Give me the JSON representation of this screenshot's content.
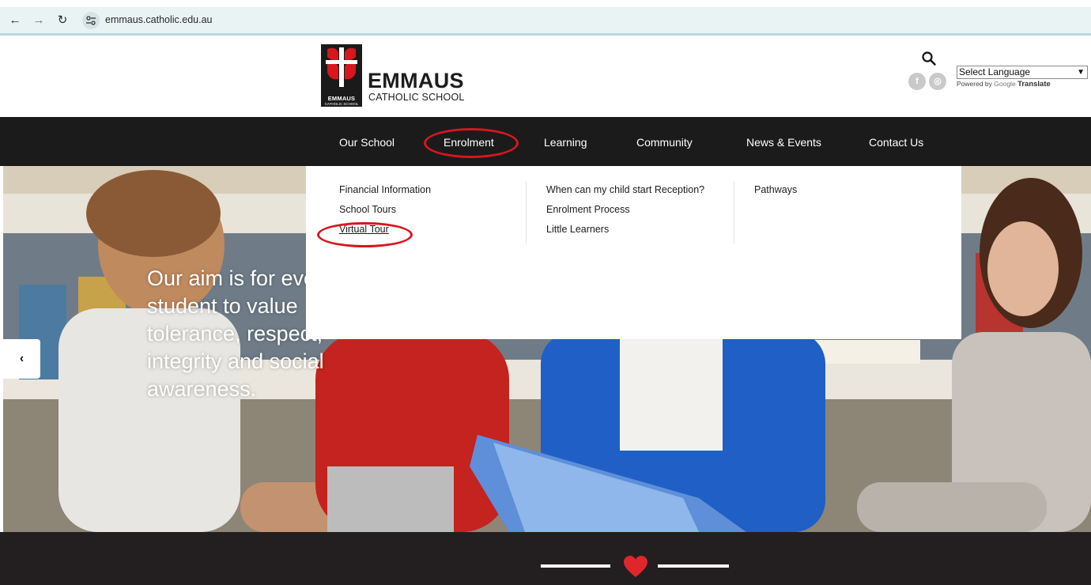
{
  "browser": {
    "url": "emmaus.catholic.edu.au",
    "back_icon": "back-arrow-icon",
    "forward_icon": "forward-arrow-icon",
    "reload_icon": "reload-icon"
  },
  "header": {
    "crest_label": "EMMAUS",
    "crest_sublabel": "CATHOLIC SCHOOL",
    "school_name": "EMMAUS",
    "school_sub": "CATHOLIC SCHOOL",
    "social": {
      "facebook": "f",
      "instagram": "◎"
    },
    "language_select": "Select Language",
    "powered_by": "Powered by",
    "google": "Google",
    "translate": "Translate"
  },
  "nav": {
    "items": [
      "Our School",
      "Enrolment",
      "Learning",
      "Community",
      "News & Events",
      "Contact Us"
    ]
  },
  "dropdown": {
    "col1": [
      "Financial Information",
      "School Tours",
      "Virtual Tour"
    ],
    "col2": [
      "When can my child start Reception?",
      "Enrolment Process",
      "Little Learners"
    ],
    "col3": [
      "Pathways"
    ]
  },
  "hero": {
    "text": "Our aim is for every student to value tolerance, respect, integrity and social awareness."
  },
  "colors": {
    "nav_bg": "#1b1b1b",
    "accent_red": "#d7161e",
    "footer_bg": "#231f20"
  }
}
